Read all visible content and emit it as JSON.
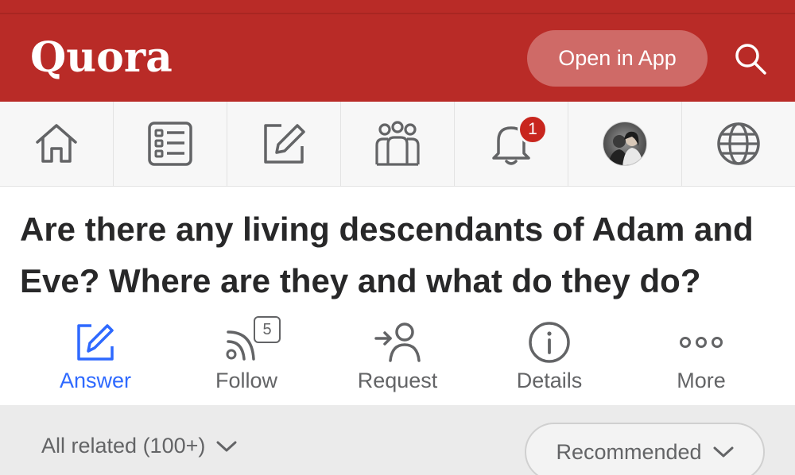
{
  "header": {
    "logo_text": "Quora",
    "open_app_label": "Open in App",
    "brand_color": "#b92b27",
    "icons": {
      "search": "search-icon"
    }
  },
  "nav": {
    "items": [
      {
        "name": "home",
        "icon": "home-icon"
      },
      {
        "name": "following",
        "icon": "list-icon"
      },
      {
        "name": "answer",
        "icon": "edit-icon"
      },
      {
        "name": "spaces",
        "icon": "spaces-icon"
      },
      {
        "name": "notifications",
        "icon": "bell-icon",
        "badge": "1"
      },
      {
        "name": "profile",
        "icon": "avatar"
      },
      {
        "name": "languages",
        "icon": "globe-icon"
      }
    ]
  },
  "question": {
    "title": "Are there any living descendants of Adam and Eve? Where are they and what do they do?"
  },
  "actions": {
    "answer": {
      "label": "Answer",
      "icon": "pencil-icon"
    },
    "follow": {
      "label": "Follow",
      "icon": "rss-icon",
      "count": "5"
    },
    "request": {
      "label": "Request",
      "icon": "request-icon"
    },
    "details": {
      "label": "Details",
      "icon": "info-icon"
    },
    "more": {
      "label": "More",
      "icon": "more-icon"
    }
  },
  "related": {
    "filter_label": "All related (100+)",
    "sort_label": "Recommended",
    "accent_color": "#2e69ff"
  }
}
